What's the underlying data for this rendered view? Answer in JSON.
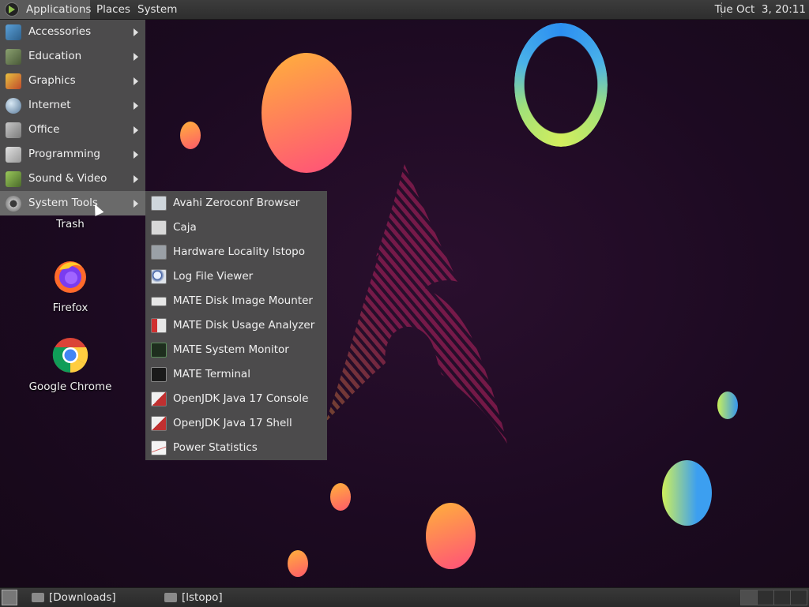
{
  "top_panel": {
    "applications_label": "Applications",
    "places_label": "Places",
    "system_label": "System",
    "clock": "Tue Oct  3, 20:11"
  },
  "desktop_icons": [
    {
      "label": "Trash",
      "icon": "trash-icon"
    },
    {
      "label": "Firefox",
      "icon": "firefox-icon"
    },
    {
      "label": "Google Chrome",
      "icon": "chrome-icon"
    }
  ],
  "applications_menu": {
    "items": [
      {
        "label": "Accessories",
        "icon": "accessories-icon"
      },
      {
        "label": "Education",
        "icon": "education-icon"
      },
      {
        "label": "Graphics",
        "icon": "graphics-icon"
      },
      {
        "label": "Internet",
        "icon": "internet-icon"
      },
      {
        "label": "Office",
        "icon": "office-icon"
      },
      {
        "label": "Programming",
        "icon": "programming-icon"
      },
      {
        "label": "Sound & Video",
        "icon": "sound-video-icon"
      },
      {
        "label": "System Tools",
        "icon": "system-tools-icon",
        "active": true
      }
    ]
  },
  "system_tools_submenu": {
    "items": [
      {
        "label": "Avahi Zeroconf Browser",
        "icon": "avahi-icon"
      },
      {
        "label": "Caja",
        "icon": "file-manager-icon"
      },
      {
        "label": "Hardware Locality lstopo",
        "icon": "hardware-icon"
      },
      {
        "label": "Log File Viewer",
        "icon": "log-viewer-icon"
      },
      {
        "label": "MATE Disk Image Mounter",
        "icon": "disk-mounter-icon"
      },
      {
        "label": "MATE Disk Usage Analyzer",
        "icon": "disk-usage-icon"
      },
      {
        "label": "MATE System Monitor",
        "icon": "system-monitor-icon"
      },
      {
        "label": "MATE Terminal",
        "icon": "terminal-icon"
      },
      {
        "label": "OpenJDK Java 17 Console",
        "icon": "java-console-icon"
      },
      {
        "label": "OpenJDK Java 17 Shell",
        "icon": "java-shell-icon"
      },
      {
        "label": "Power Statistics",
        "icon": "power-statistics-icon"
      }
    ]
  },
  "bottom_panel": {
    "tasks": [
      {
        "label": "[Downloads]",
        "icon": "folder-icon"
      },
      {
        "label": "[lstopo]",
        "icon": "window-icon"
      }
    ]
  }
}
